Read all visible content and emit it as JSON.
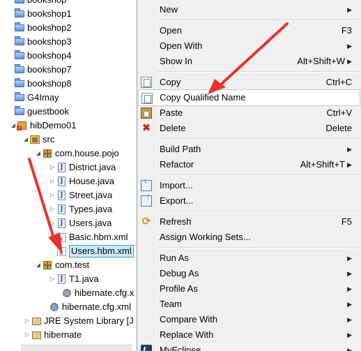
{
  "tree": {
    "items": [
      {
        "label": "bookshop",
        "icon": "folder-icon",
        "twisty": ""
      },
      {
        "label": "bookshop1",
        "icon": "folder-icon",
        "twisty": ""
      },
      {
        "label": "bookshop2",
        "icon": "folder-icon",
        "twisty": ""
      },
      {
        "label": "bookshop3",
        "icon": "folder-icon",
        "twisty": ""
      },
      {
        "label": "bookshop4",
        "icon": "folder-icon",
        "twisty": ""
      },
      {
        "label": "bookshop7",
        "icon": "folder-icon",
        "twisty": ""
      },
      {
        "label": "bookshop8",
        "icon": "folder-icon",
        "twisty": ""
      },
      {
        "label": "G4Imay",
        "icon": "folder-icon",
        "twisty": ""
      },
      {
        "label": "guestbook",
        "icon": "folder-icon",
        "twisty": ""
      },
      {
        "label": "hibDemo01",
        "icon": "project-icon",
        "twisty": "◢"
      },
      {
        "label": "src",
        "icon": "source-folder-icon",
        "twisty": "◢"
      },
      {
        "label": "com.house.pojo",
        "icon": "package-icon",
        "twisty": "◢"
      },
      {
        "label": "District.java",
        "icon": "java-file-icon",
        "twisty": "▷"
      },
      {
        "label": "House.java",
        "icon": "java-file-icon",
        "twisty": "▷"
      },
      {
        "label": "Street.java",
        "icon": "java-file-icon",
        "twisty": "▷"
      },
      {
        "label": "Types.java",
        "icon": "java-file-icon",
        "twisty": "▷"
      },
      {
        "label": "Users.java",
        "icon": "java-file-icon",
        "twisty": "▷"
      },
      {
        "label": "Basic.hbm.xml",
        "icon": "xml-file-icon",
        "twisty": ""
      },
      {
        "label": "Users.hbm.xml",
        "icon": "xml-file-icon",
        "twisty": ""
      },
      {
        "label": "com.test",
        "icon": "package-icon",
        "twisty": "◢"
      },
      {
        "label": "T1.java",
        "icon": "java-file-icon",
        "twisty": "▷"
      },
      {
        "label": "hibernate.cfg.x",
        "icon": "gear-icon",
        "twisty": ""
      },
      {
        "label": "hibernate.cfg.xml",
        "icon": "gear-icon",
        "twisty": ""
      },
      {
        "label": "JRE System Library [J",
        "icon": "library-icon",
        "twisty": "▷"
      },
      {
        "label": "hibernate",
        "icon": "folder-icon",
        "twisty": "▷"
      }
    ],
    "selected_label": "Users.hbm.xml"
  },
  "menu": {
    "items": [
      {
        "label": "New",
        "shortcut": "",
        "submenu": true,
        "icon": ""
      },
      {
        "label": "Open",
        "shortcut": "F3",
        "submenu": false,
        "icon": ""
      },
      {
        "label": "Open With",
        "shortcut": "",
        "submenu": true,
        "icon": ""
      },
      {
        "label": "Show In",
        "shortcut": "Alt+Shift+W",
        "submenu": true,
        "icon": ""
      },
      {
        "label": "Copy",
        "shortcut": "Ctrl+C",
        "submenu": false,
        "icon": "copy-icon"
      },
      {
        "label": "Copy Qualified Name",
        "shortcut": "",
        "submenu": false,
        "icon": "copy-qualified-name-icon"
      },
      {
        "label": "Paste",
        "shortcut": "Ctrl+V",
        "submenu": false,
        "icon": "paste-icon"
      },
      {
        "label": "Delete",
        "shortcut": "Delete",
        "submenu": false,
        "icon": "delete-icon"
      },
      {
        "label": "Build Path",
        "shortcut": "",
        "submenu": true,
        "icon": ""
      },
      {
        "label": "Refactor",
        "shortcut": "Alt+Shift+T",
        "submenu": true,
        "icon": ""
      },
      {
        "label": "Import...",
        "shortcut": "",
        "submenu": false,
        "icon": "import-icon"
      },
      {
        "label": "Export...",
        "shortcut": "",
        "submenu": false,
        "icon": "export-icon"
      },
      {
        "label": "Refresh",
        "shortcut": "F5",
        "submenu": false,
        "icon": "refresh-icon"
      },
      {
        "label": "Assign Working Sets...",
        "shortcut": "",
        "submenu": false,
        "icon": ""
      },
      {
        "label": "Run As",
        "shortcut": "",
        "submenu": true,
        "icon": ""
      },
      {
        "label": "Debug As",
        "shortcut": "",
        "submenu": true,
        "icon": ""
      },
      {
        "label": "Profile As",
        "shortcut": "",
        "submenu": true,
        "icon": ""
      },
      {
        "label": "Team",
        "shortcut": "",
        "submenu": true,
        "icon": ""
      },
      {
        "label": "Compare With",
        "shortcut": "",
        "submenu": true,
        "icon": ""
      },
      {
        "label": "Replace With",
        "shortcut": "",
        "submenu": true,
        "icon": ""
      },
      {
        "label": "MyEclipse",
        "shortcut": "",
        "submenu": true,
        "icon": "myeclipse-icon"
      }
    ],
    "hovered_label": "Copy Qualified Name"
  },
  "colors": {
    "annotation_arrow": "#e8322a",
    "selection_border": "#26a0da",
    "selection_fill": "#cbe8f6",
    "menu_background": "#f0f0f0"
  }
}
